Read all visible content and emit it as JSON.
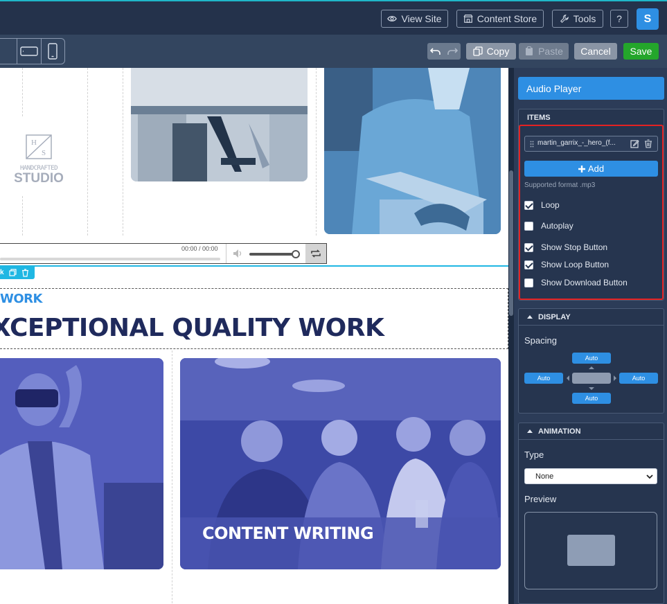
{
  "topbar": {
    "view_site": "View Site",
    "content_store": "Content Store",
    "tools": "Tools",
    "help": "?",
    "avatar_letter": "S"
  },
  "toolbar": {
    "copy": "Copy",
    "paste": "Paste",
    "cancel": "Cancel",
    "save": "Save"
  },
  "canvas": {
    "logo_top": "H",
    "logo_bottom": "S",
    "logo_line1": "HANDCRAFTED",
    "logo_line2": "STUDIO",
    "audio_time": "00:00 / 00:00",
    "section_tag": "k",
    "eyebrow": "WORK",
    "heading": "XCEPTIONAL QUALITY WORK",
    "card_caption": "CONTENT WRITING"
  },
  "panel": {
    "title": "Audio Player",
    "items_header": "ITEMS",
    "item_name": "martin_garrix_-_hero_(f...",
    "add_label": "Add",
    "supported_format": "Supported format .mp3",
    "options": [
      {
        "label": "Loop",
        "checked": true
      },
      {
        "label": "Autoplay",
        "checked": false
      },
      {
        "label": "Show Stop Button",
        "checked": true
      },
      {
        "label": "Show Loop Button",
        "checked": true
      },
      {
        "label": "Show Download Button",
        "checked": false
      }
    ],
    "display_header": "DISPLAY",
    "spacing_label": "Spacing",
    "spacing_top": "Auto",
    "spacing_left": "Auto",
    "spacing_right": "Auto",
    "spacing_bottom": "Auto",
    "animation_header": "ANIMATION",
    "type_label": "Type",
    "type_value": "None",
    "preview_label": "Preview"
  },
  "colors": {
    "accent": "#2e8fe3",
    "save_green": "#24a62b",
    "highlight_red": "#e52222",
    "selection_cyan": "#1fb7e3",
    "heading_navy": "#1f2a5c"
  }
}
